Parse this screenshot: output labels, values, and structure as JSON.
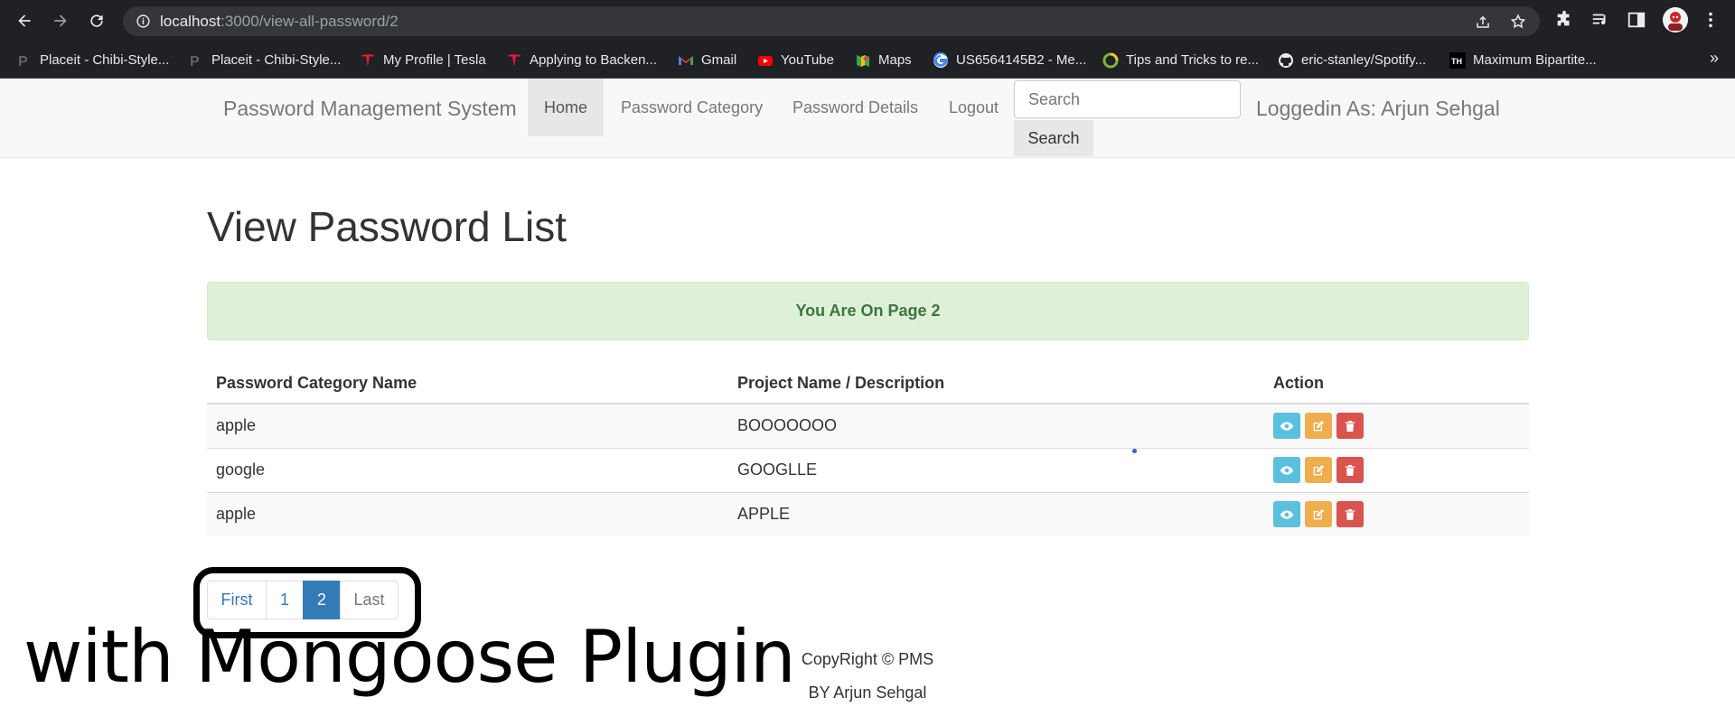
{
  "browser": {
    "url_host": "localhost",
    "url_path": ":3000/view-all-password/2",
    "bookmarks": [
      {
        "label": "Placeit - Chibi-Style...",
        "icon": "placeit-icon"
      },
      {
        "label": "Placeit - Chibi-Style...",
        "icon": "placeit-icon"
      },
      {
        "label": "My Profile | Tesla",
        "icon": "tesla-icon"
      },
      {
        "label": "Applying to Backen...",
        "icon": "tesla-icon"
      },
      {
        "label": "Gmail",
        "icon": "gmail-icon"
      },
      {
        "label": "YouTube",
        "icon": "youtube-icon"
      },
      {
        "label": "Maps",
        "icon": "maps-icon"
      },
      {
        "label": "US6564145B2 - Me...",
        "icon": "google-icon"
      },
      {
        "label": "Tips and Tricks to re...",
        "icon": "ring-icon"
      },
      {
        "label": "eric-stanley/Spotify...",
        "icon": "github-icon"
      },
      {
        "label": "Maximum Bipartite...",
        "icon": "th-icon"
      }
    ],
    "more": "»"
  },
  "navbar": {
    "brand": "Password Management System",
    "items": [
      "Home",
      "Password Category",
      "Password Details",
      "Logout"
    ],
    "active_item": "Home",
    "search_placeholder": "Search",
    "search_button": "Search",
    "logged_in": "Loggedin As: Arjun Sehgal"
  },
  "main": {
    "title": "View Password List",
    "alert": "You Are On Page 2",
    "table": {
      "headers": [
        "Password Category Name",
        "Project Name / Description",
        "Action"
      ],
      "rows": [
        {
          "category": "apple",
          "project": "BOOOOOOO"
        },
        {
          "category": "google",
          "project": "GOOGLLE"
        },
        {
          "category": "apple",
          "project": "APPLE"
        }
      ]
    },
    "pagination": {
      "first": "First",
      "pages": [
        "1",
        "2"
      ],
      "current": "2",
      "last": "Last"
    }
  },
  "overlay_caption": "with Mongoose Plugin",
  "footer": {
    "line1": "CopyRight © PMS",
    "line2": "BY Arjun Sehgal"
  },
  "colors": {
    "alert_bg": "#dff0d8",
    "alert_text": "#3c763d",
    "primary": "#337ab7",
    "view_btn": "#5bc0de",
    "edit_btn": "#f0ad4e",
    "delete_btn": "#d9534f"
  }
}
